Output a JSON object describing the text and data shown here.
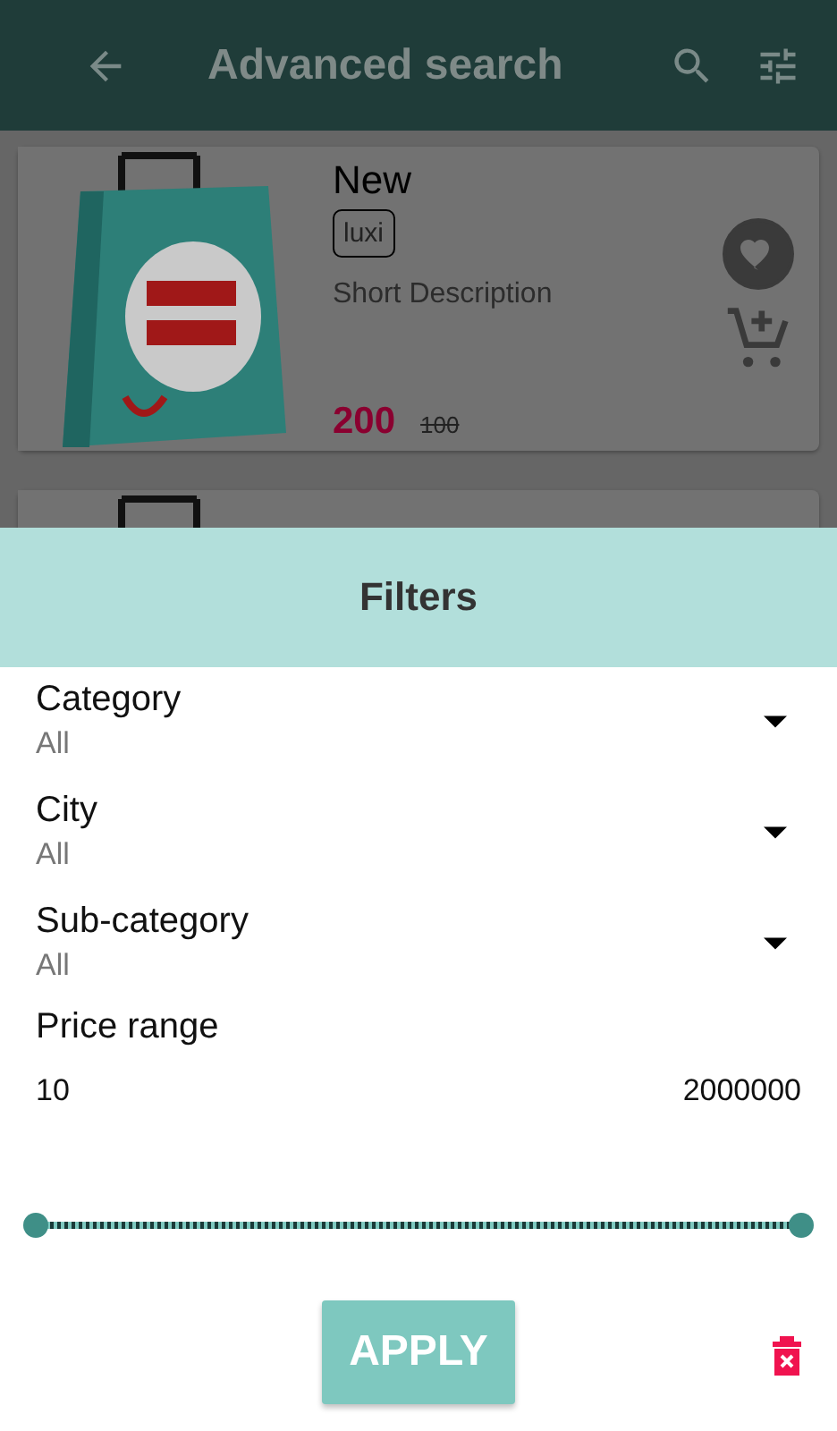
{
  "app_bar": {
    "title": "Advanced search"
  },
  "products": [
    {
      "name": "New",
      "tag": "luxi",
      "description": "Short Description",
      "price": "200",
      "old_price": "100",
      "favorite": true
    },
    {
      "kind": "picture"
    }
  ],
  "filters": {
    "title": "Filters",
    "dropdowns": [
      {
        "label": "Category",
        "value": "All"
      },
      {
        "label": "City",
        "value": "All"
      },
      {
        "label": "Sub-category",
        "value": "All"
      }
    ],
    "price_range": {
      "label": "Price range",
      "min": "10",
      "max": "2000000"
    },
    "apply": "APPLY"
  }
}
